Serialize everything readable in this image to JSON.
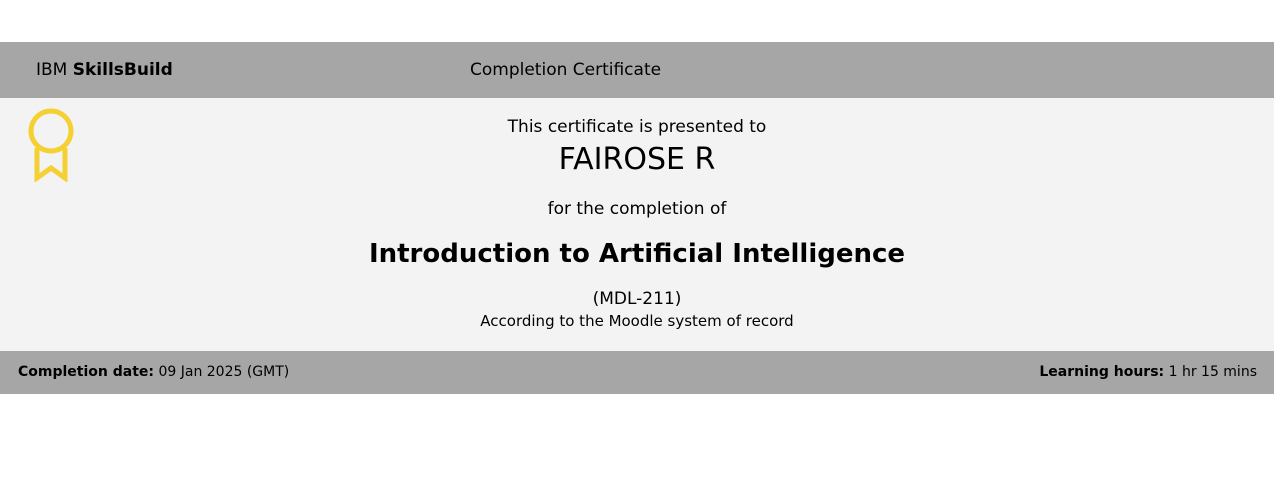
{
  "header": {
    "brand_prefix": "IBM",
    "brand_name": "SkillsBuild",
    "title": "Completion Certificate"
  },
  "certificate": {
    "presented_to": "This certificate is presented to",
    "recipient_name": "FAIROSE R",
    "for_completion": "for the completion of",
    "course_title": "Introduction to Artificial Intelligence",
    "course_code": "(MDL-211)",
    "record_system": "According to the Moodle system of record",
    "badge_icon": "award-ribbon-icon",
    "badge_color": "#f5d033"
  },
  "footer": {
    "completion_date_label": "Completion date:",
    "completion_date_value": "09 Jan 2025 (GMT)",
    "learning_hours_label": "Learning hours:",
    "learning_hours_value": "1 hr 15 mins"
  },
  "colors": {
    "band": "#a6a6a6",
    "body": "#f3f3f3"
  }
}
